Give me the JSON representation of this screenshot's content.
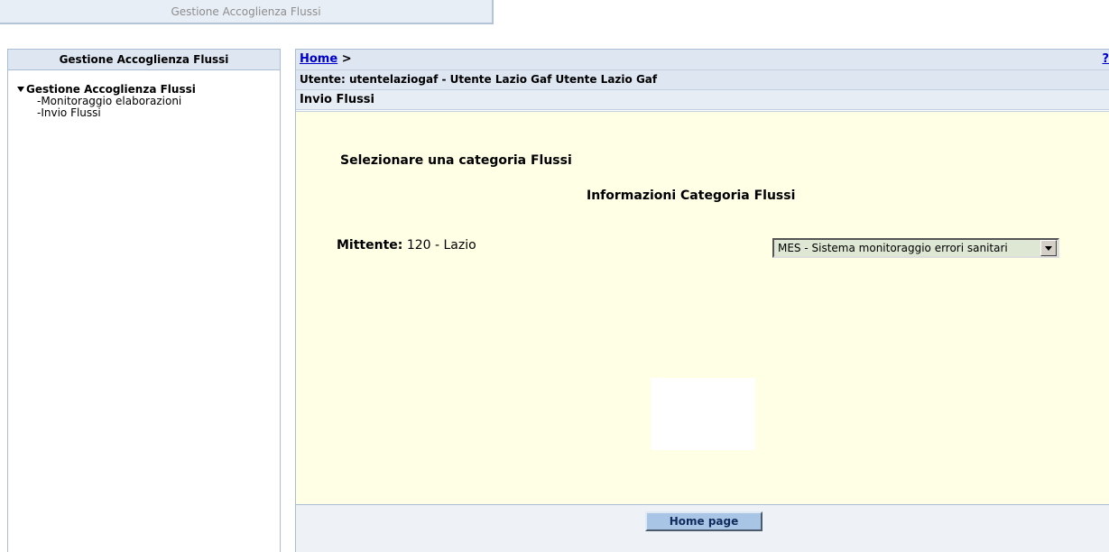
{
  "top_tab": {
    "label": "Gestione Accoglienza Flussi"
  },
  "sidebar": {
    "header": "Gestione Accoglienza Flussi",
    "root_label": "Gestione Accoglienza Flussi",
    "items": [
      {
        "label": "-Monitoraggio elaborazioni"
      },
      {
        "label": "-Invio Flussi"
      }
    ]
  },
  "breadcrumb": {
    "home": "Home",
    "separator": ">",
    "help": "?"
  },
  "user_line": "Utente: utentelaziogaf - Utente Lazio Gaf Utente Lazio Gaf",
  "page_title": "Invio Flussi",
  "content": {
    "select_heading": "Selezionare una categoria Flussi",
    "info_heading": "Informazioni Categoria Flussi",
    "sender_label": "Mittente:",
    "sender_value": "120 - Lazio",
    "category_selected": "MES - Sistema monitoraggio errori sanitari"
  },
  "footer": {
    "home_button": "Home page"
  },
  "colors": {
    "header_bg": "#dde6f1",
    "content_bg": "#ffffe6",
    "link": "#0000cc",
    "button_bg": "#a9c5e5"
  }
}
